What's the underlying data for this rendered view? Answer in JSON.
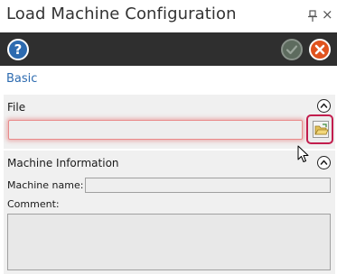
{
  "window": {
    "title": "Load Machine Configuration",
    "pin_icon": "pin-icon",
    "close_icon": "close-icon",
    "close_glyph": "×"
  },
  "toolbar": {
    "help_glyph": "?",
    "help_icon": "help-icon",
    "ok_icon": "checkmark-icon",
    "cancel_icon": "cancel-x-icon",
    "background_color": "#2f2f2f",
    "help_color": "#2d6bb0",
    "cancel_color": "#e0531e",
    "ok_color": "#5d6b5e"
  },
  "tabs": {
    "basic_label": "Basic"
  },
  "file_section": {
    "title": "File",
    "path_value": "",
    "browse_icon": "open-folder-icon",
    "validation_color": "#e98a8a",
    "highlight_color": "#c21d4d"
  },
  "machine_section": {
    "title": "Machine Information",
    "name_label": "Machine name:",
    "name_value": "",
    "comment_label": "Comment:",
    "comment_value": ""
  },
  "colors": {
    "link": "#2d6bb0",
    "section_bg": "#f0f0f0"
  }
}
